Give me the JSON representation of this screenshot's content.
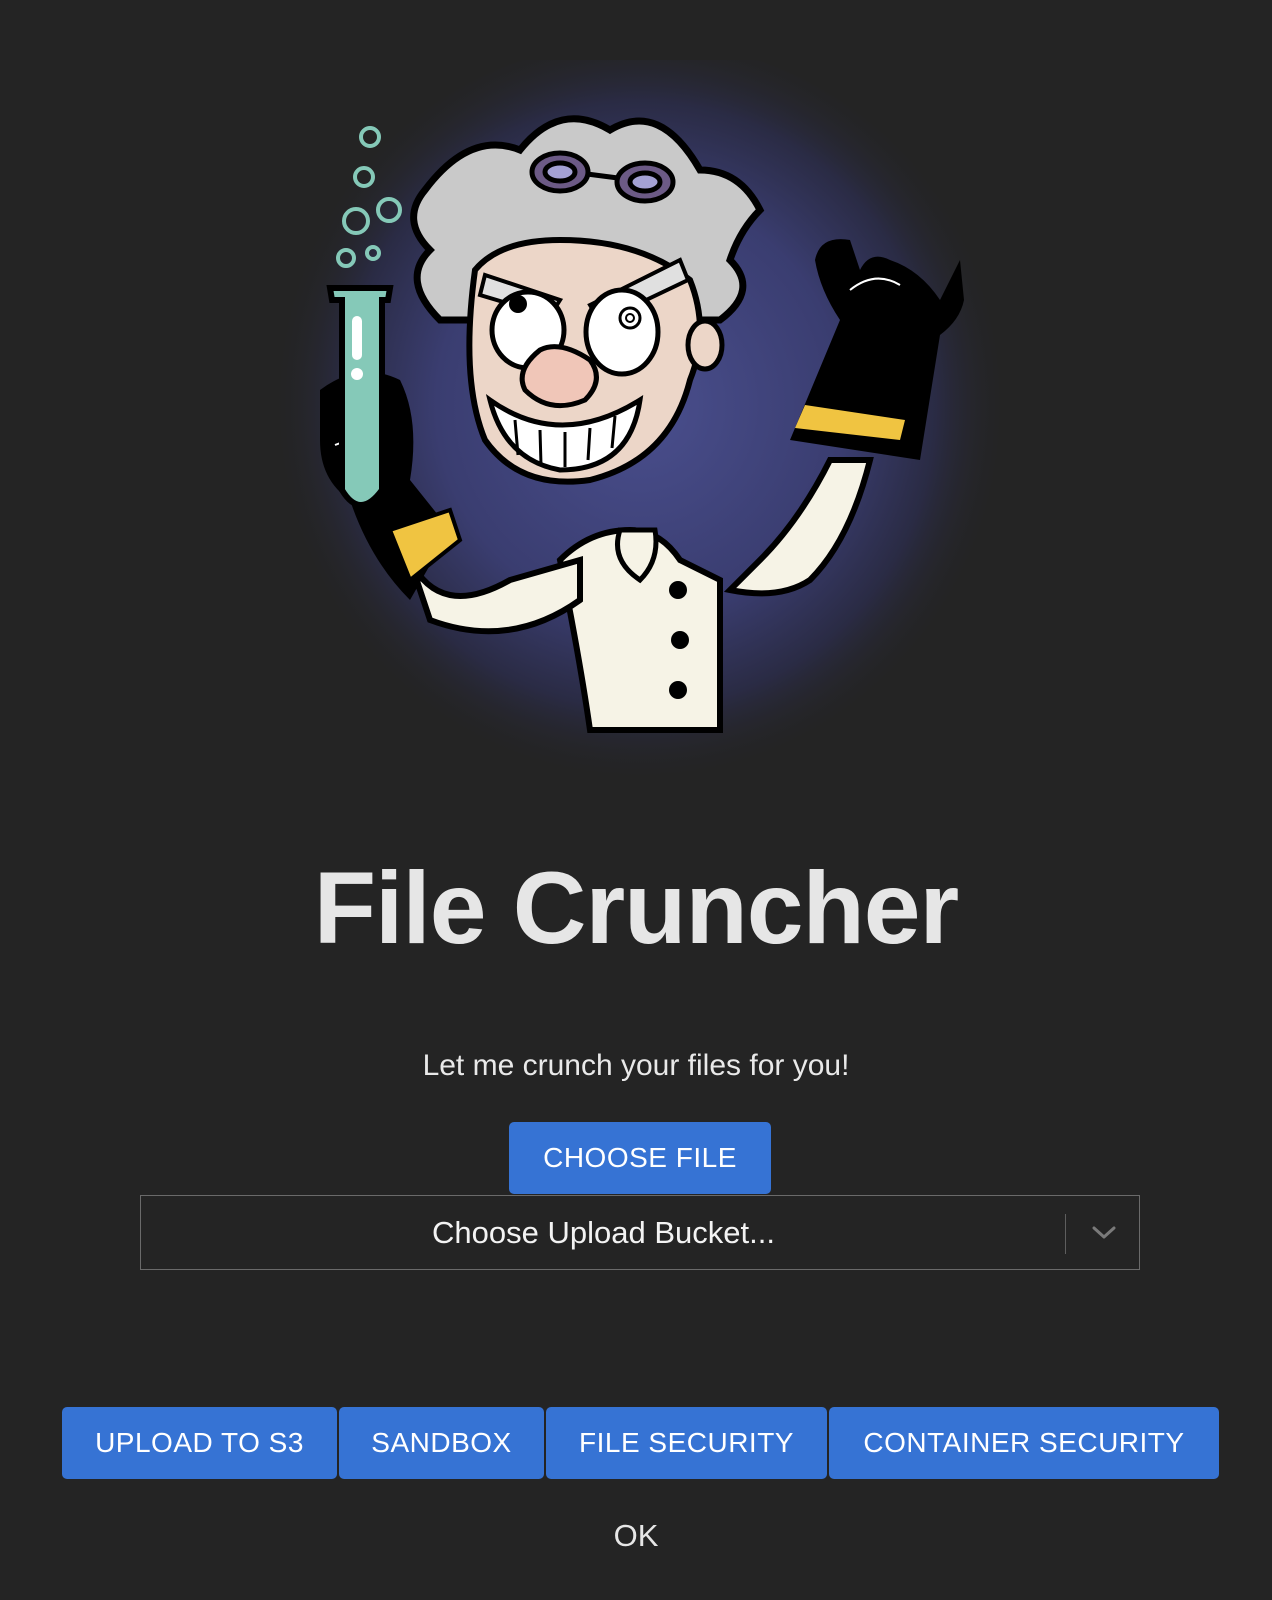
{
  "app": {
    "title": "File Cruncher",
    "tagline": "Let me crunch your files for you!"
  },
  "hero": {
    "icon": "mad-scientist-illustration"
  },
  "controls": {
    "choose_file_label": "CHOOSE FILE",
    "bucket_select": {
      "placeholder": "Choose Upload Bucket...",
      "icon": "chevron-down-icon"
    }
  },
  "actions": [
    {
      "label": "UPLOAD TO S3"
    },
    {
      "label": "SANDBOX"
    },
    {
      "label": "FILE SECURITY"
    },
    {
      "label": "CONTAINER SECURITY"
    }
  ],
  "status": {
    "text": "OK"
  },
  "colors": {
    "background": "#242424",
    "button": "#3673d4",
    "text": "#e6e6e6"
  }
}
